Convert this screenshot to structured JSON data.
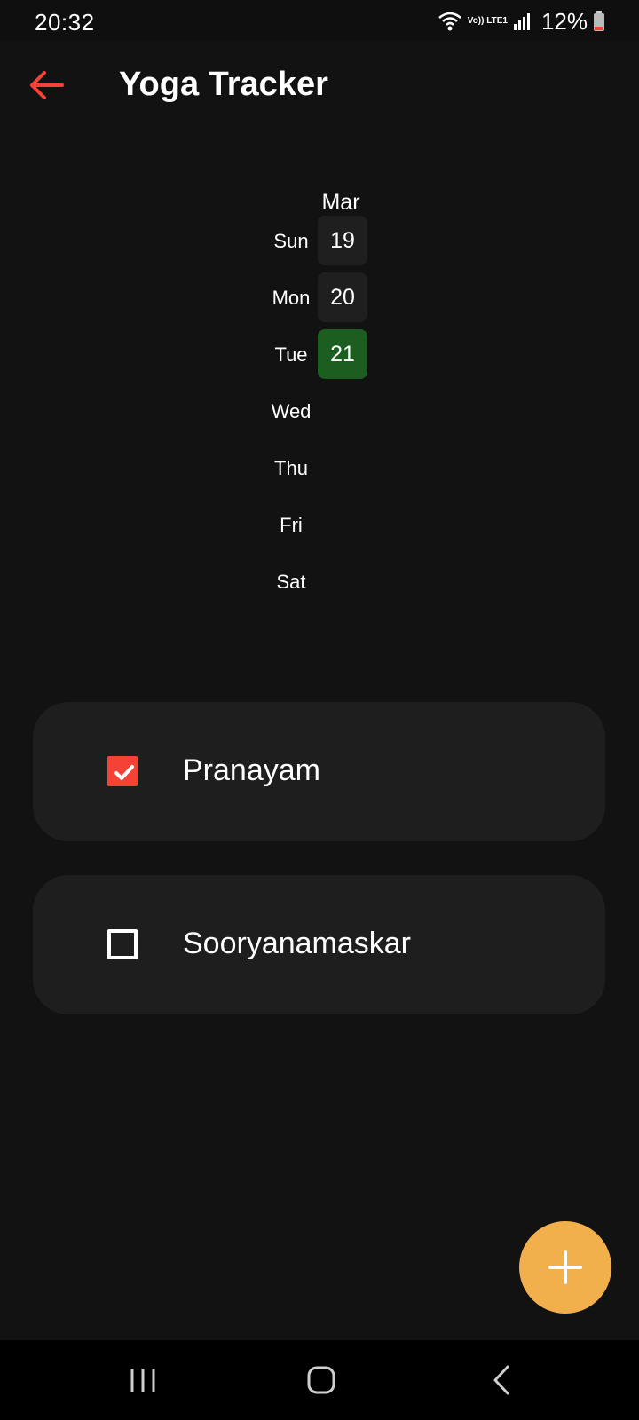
{
  "status_bar": {
    "time": "20:32",
    "network_label": "Vo)) LTE1",
    "battery_percent": "12%",
    "battery_level": 0.12
  },
  "app_bar": {
    "title": "Yoga Tracker",
    "back_icon": "arrow-left-icon",
    "accent_color": "#f44336"
  },
  "calendar": {
    "month": "Mar",
    "days": [
      {
        "label": "Sun",
        "date": "19",
        "state": "past"
      },
      {
        "label": "Mon",
        "date": "20",
        "state": "past"
      },
      {
        "label": "Tue",
        "date": "21",
        "state": "today"
      },
      {
        "label": "Wed",
        "date": ""
      },
      {
        "label": "Thu",
        "date": ""
      },
      {
        "label": "Fri",
        "date": ""
      },
      {
        "label": "Sat",
        "date": ""
      }
    ],
    "today_color": "#1b5e20"
  },
  "habits": [
    {
      "name": "Pranayam",
      "checked": true
    },
    {
      "name": "Sooryanamaskar",
      "checked": false
    }
  ],
  "fab": {
    "icon": "plus-icon",
    "color": "#f2b04d"
  },
  "nav_bar": {
    "icons": [
      "recent-apps-icon",
      "home-icon",
      "back-icon"
    ]
  }
}
